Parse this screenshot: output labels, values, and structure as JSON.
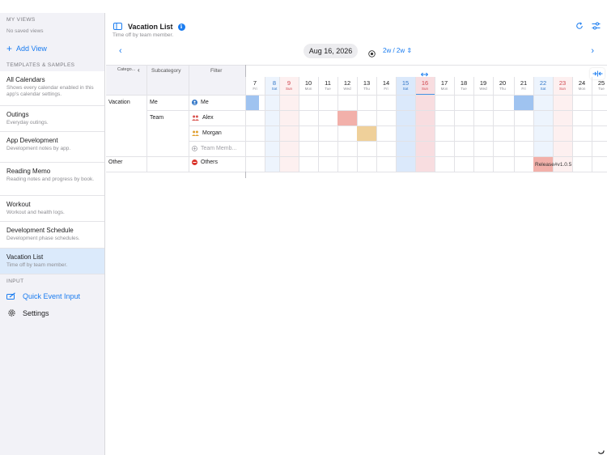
{
  "sidebar": {
    "my_views_header": "MY VIEWS",
    "no_saved": "No saved views",
    "add_view": "Add View",
    "templates_header": "TEMPLATES & SAMPLES",
    "calendars": [
      {
        "title": "All Calendars",
        "desc": "Shows every calendar enabled in this app's calendar settings."
      },
      {
        "title": "Outings",
        "desc": "Everyday outings."
      },
      {
        "title": "App Development",
        "desc": "Development notes by app."
      },
      {
        "title": "Reading Memo",
        "desc": "Reading notes and progress by book."
      },
      {
        "title": "Workout",
        "desc": "Workout and health logs."
      },
      {
        "title": "Development Schedule",
        "desc": "Development phase schedules."
      },
      {
        "title": "Vacation List",
        "desc": "Time off by team member.",
        "active": true
      }
    ],
    "input_header": "INPUT",
    "quick_event": "Quick Event Input",
    "settings": "Settings"
  },
  "header": {
    "title": "Vacation List",
    "subtitle": "Time off by team member.",
    "date": "Aug 16, 2026",
    "range": "2w / 2w ⇕"
  },
  "grid": {
    "col_category": "Catego...",
    "col_subcategory": "Subcategory",
    "col_filter": "Filter",
    "days": [
      {
        "n": "7",
        "w": "Fri"
      },
      {
        "n": "8",
        "w": "Sat",
        "t": "sat"
      },
      {
        "n": "9",
        "w": "Sun",
        "t": "sun"
      },
      {
        "n": "10",
        "w": "Mon"
      },
      {
        "n": "11",
        "w": "Tue"
      },
      {
        "n": "12",
        "w": "Wed"
      },
      {
        "n": "13",
        "w": "Thu"
      },
      {
        "n": "14",
        "w": "Fri"
      },
      {
        "n": "15",
        "w": "Sat",
        "t": "sat"
      },
      {
        "n": "16",
        "w": "Sun",
        "t": "sun"
      },
      {
        "n": "17",
        "w": "Mon"
      },
      {
        "n": "18",
        "w": "Tue"
      },
      {
        "n": "19",
        "w": "Wed"
      },
      {
        "n": "20",
        "w": "Thu"
      },
      {
        "n": "21",
        "w": "Fri"
      },
      {
        "n": "22",
        "w": "Sat",
        "t": "sat"
      },
      {
        "n": "23",
        "w": "Sun",
        "t": "sun"
      },
      {
        "n": "24",
        "w": "Mon"
      },
      {
        "n": "25",
        "w": "Tue"
      }
    ],
    "rows": {
      "vacation": "Vacation",
      "me_sub": "Me",
      "me_filter": "Me",
      "team_sub": "Team",
      "alex": "Alex",
      "morgan": "Morgan",
      "team_member": "Team Memb...",
      "other": "Other",
      "others": "Others"
    },
    "events": {
      "release": "Release",
      "version": "#v1.0.5"
    },
    "colors": {
      "me": "#9fc3f0",
      "alex": "#f2b0aa",
      "morgan": "#efd09a",
      "release": "#f2b0aa",
      "accent": "#1a7cf0"
    }
  }
}
